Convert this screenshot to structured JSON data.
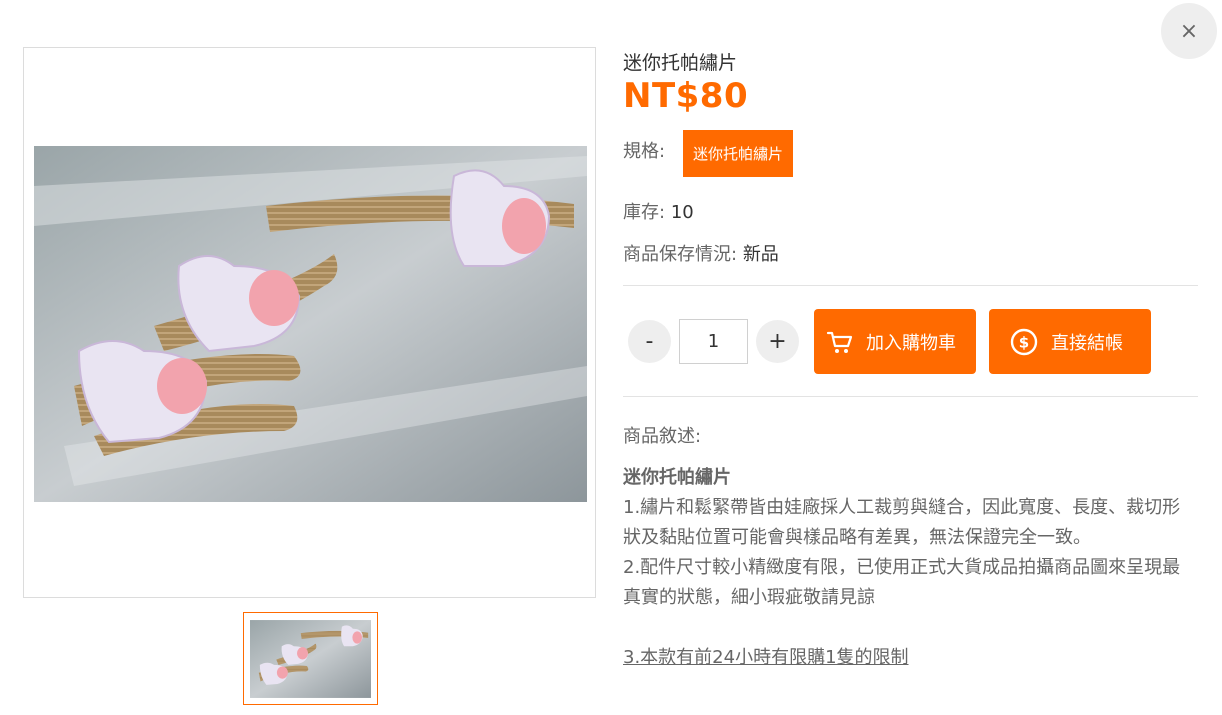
{
  "close_label": "×",
  "product": {
    "title": "迷你托帕繡片",
    "price": "NT$80",
    "spec_label": "規格:",
    "spec_option": "迷你托帕繡片",
    "stock_label": "庫存:",
    "stock_value": "10",
    "condition_label": "商品保存情況:",
    "condition_value": "新品"
  },
  "quantity": {
    "minus": "-",
    "value": "1",
    "plus": "+"
  },
  "actions": {
    "add_to_cart": "加入購物車",
    "checkout": "直接結帳"
  },
  "description": {
    "label": "商品敘述:",
    "heading": "迷你托帕繡片",
    "line1": "1.繡片和鬆緊帶皆由娃廠採人工裁剪與縫合，因此寬度、長度、裁切形狀及黏貼位置可能會與樣品略有差異，無法保證完全一致。",
    "line2": "2.配件尺寸較小精緻度有限，已使用正式大貨成品拍攝商品圖來呈現最真實的狀態，細小瑕疵敬請見諒",
    "line3": "3.本款有前24小時有限購1隻的限制"
  },
  "colors": {
    "accent": "#ff6a00",
    "muted_text": "#666666",
    "button_gray": "#eeeeee"
  },
  "icons": {
    "close": "close-icon",
    "cart": "cart-icon",
    "coin": "dollar-coin-icon"
  }
}
